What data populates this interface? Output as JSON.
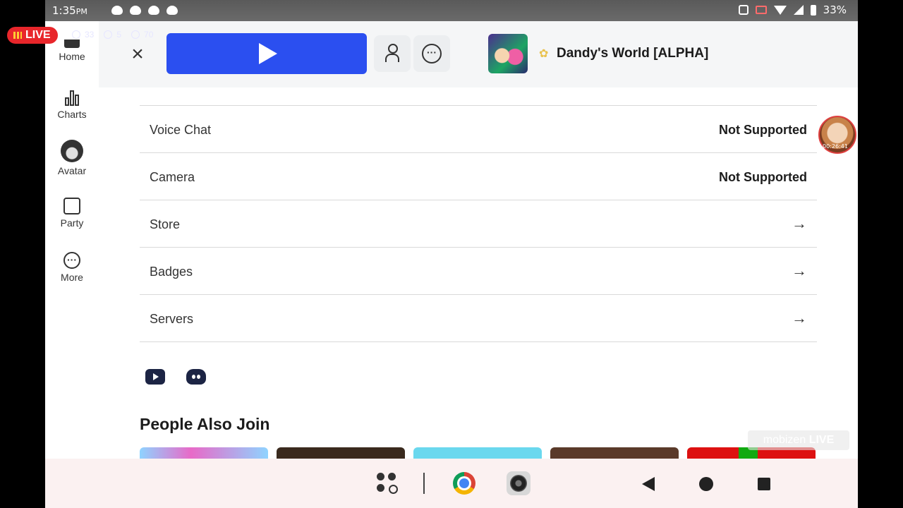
{
  "status_bar": {
    "time": "1:35",
    "ampm": "PM",
    "battery": "33%"
  },
  "live_overlay": {
    "label": "LIVE",
    "viewers": "33",
    "likes": "5",
    "comments": "70"
  },
  "header": {
    "game_title": "Dandy's World [ALPHA]",
    "close": "×",
    "more": "···"
  },
  "sidebar": {
    "items": [
      {
        "label": "Home"
      },
      {
        "label": "Charts"
      },
      {
        "label": "Avatar"
      },
      {
        "label": "Party"
      },
      {
        "label": "More"
      }
    ]
  },
  "details": {
    "rows": [
      {
        "label": "Voice Chat",
        "value": "Not Supported"
      },
      {
        "label": "Camera",
        "value": "Not Supported"
      },
      {
        "label": "Store",
        "arrow": "→"
      },
      {
        "label": "Badges",
        "arrow": "→"
      },
      {
        "label": "Servers",
        "arrow": "→"
      }
    ]
  },
  "people_also_join": {
    "title": "People Also Join"
  },
  "floating_bubble": {
    "time": "00:26:41"
  },
  "watermark": {
    "text": "mobizen",
    "brand": "LIVE"
  },
  "colors": {
    "accent": "#2b4ff0",
    "live": "#e8262b"
  }
}
